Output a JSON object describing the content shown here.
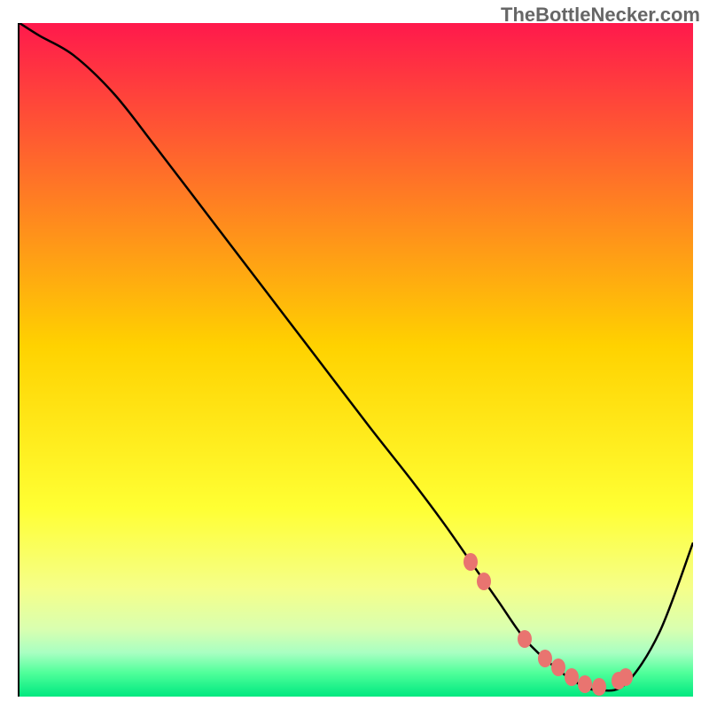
{
  "attribution": "TheBottleNecker.com",
  "chart_data": {
    "type": "line",
    "title": "",
    "xlabel": "",
    "ylabel": "",
    "xlim": [
      0,
      100
    ],
    "ylim": [
      0,
      105
    ],
    "gradient_stops": [
      {
        "pos": 0.0,
        "color": "#ff194c"
      },
      {
        "pos": 0.48,
        "color": "#ffd200"
      },
      {
        "pos": 0.72,
        "color": "#ffff33"
      },
      {
        "pos": 0.84,
        "color": "#f5ff8a"
      },
      {
        "pos": 0.9,
        "color": "#d9ffb0"
      },
      {
        "pos": 0.935,
        "color": "#a8ffc2"
      },
      {
        "pos": 0.965,
        "color": "#4fff9a"
      },
      {
        "pos": 1.0,
        "color": "#00e880"
      }
    ],
    "curve": {
      "x": [
        0,
        3,
        8,
        14,
        20,
        28,
        36,
        44,
        52,
        58,
        63,
        67,
        71,
        75,
        79,
        83,
        86,
        90,
        95,
        100
      ],
      "y": [
        105,
        103,
        100,
        94,
        86,
        75,
        64,
        53,
        42,
        34,
        27,
        21,
        15,
        9,
        5,
        2,
        1,
        2,
        10,
        24
      ]
    },
    "markers": {
      "x": [
        67,
        69,
        75,
        78,
        80,
        82,
        84,
        86,
        89,
        90
      ],
      "y": [
        21,
        18,
        9,
        6,
        4.5,
        3,
        2,
        1.5,
        2.5,
        3
      ]
    }
  }
}
